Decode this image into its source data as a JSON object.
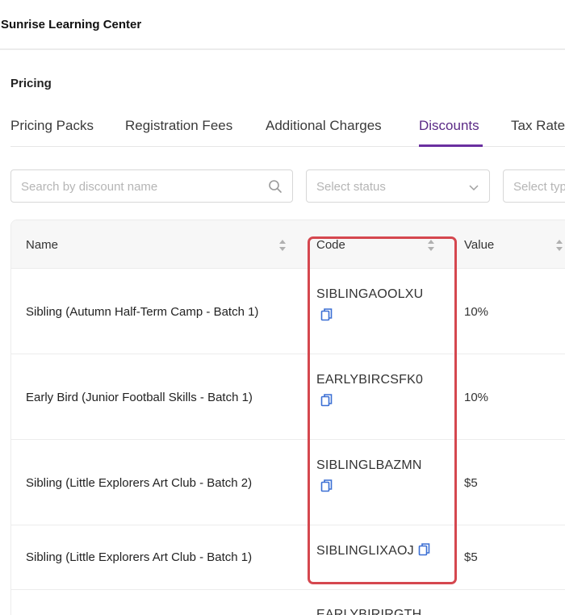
{
  "app": {
    "title": "Sunrise Learning Center"
  },
  "page": {
    "section_title": "Pricing"
  },
  "tabs": [
    {
      "label": "Pricing Packs"
    },
    {
      "label": "Registration Fees"
    },
    {
      "label": "Additional Charges"
    },
    {
      "label": "Discounts",
      "active": true
    },
    {
      "label": "Tax Rate"
    }
  ],
  "filters": {
    "search_placeholder": "Search by discount name",
    "status_placeholder": "Select status",
    "type_placeholder": "Select typ"
  },
  "table": {
    "columns": {
      "name": "Name",
      "code": "Code",
      "value": "Value"
    },
    "rows": [
      {
        "name": "Sibling (Autumn Half-Term Camp - Batch 1)",
        "code": "SIBLINGAOOLXU",
        "value": "10%"
      },
      {
        "name": "Early Bird (Junior Football Skills - Batch 1)",
        "code": "EARLYBIRCSFK0",
        "value": "10%"
      },
      {
        "name": "Sibling (Little Explorers Art Club - Batch 2)",
        "code": "SIBLINGLBAZMN",
        "value": "$5"
      },
      {
        "name": "Sibling (Little Explorers Art Club - Batch 1)",
        "code": "SIBLINGLIXAOJ",
        "value": "$5"
      },
      {
        "name": "",
        "code": "EARLYBIRIRGTH",
        "value": ""
      }
    ]
  },
  "colors": {
    "accent": "#6a2fa0",
    "highlight": "#d5474f",
    "copy_icon": "#3b6fd4"
  }
}
